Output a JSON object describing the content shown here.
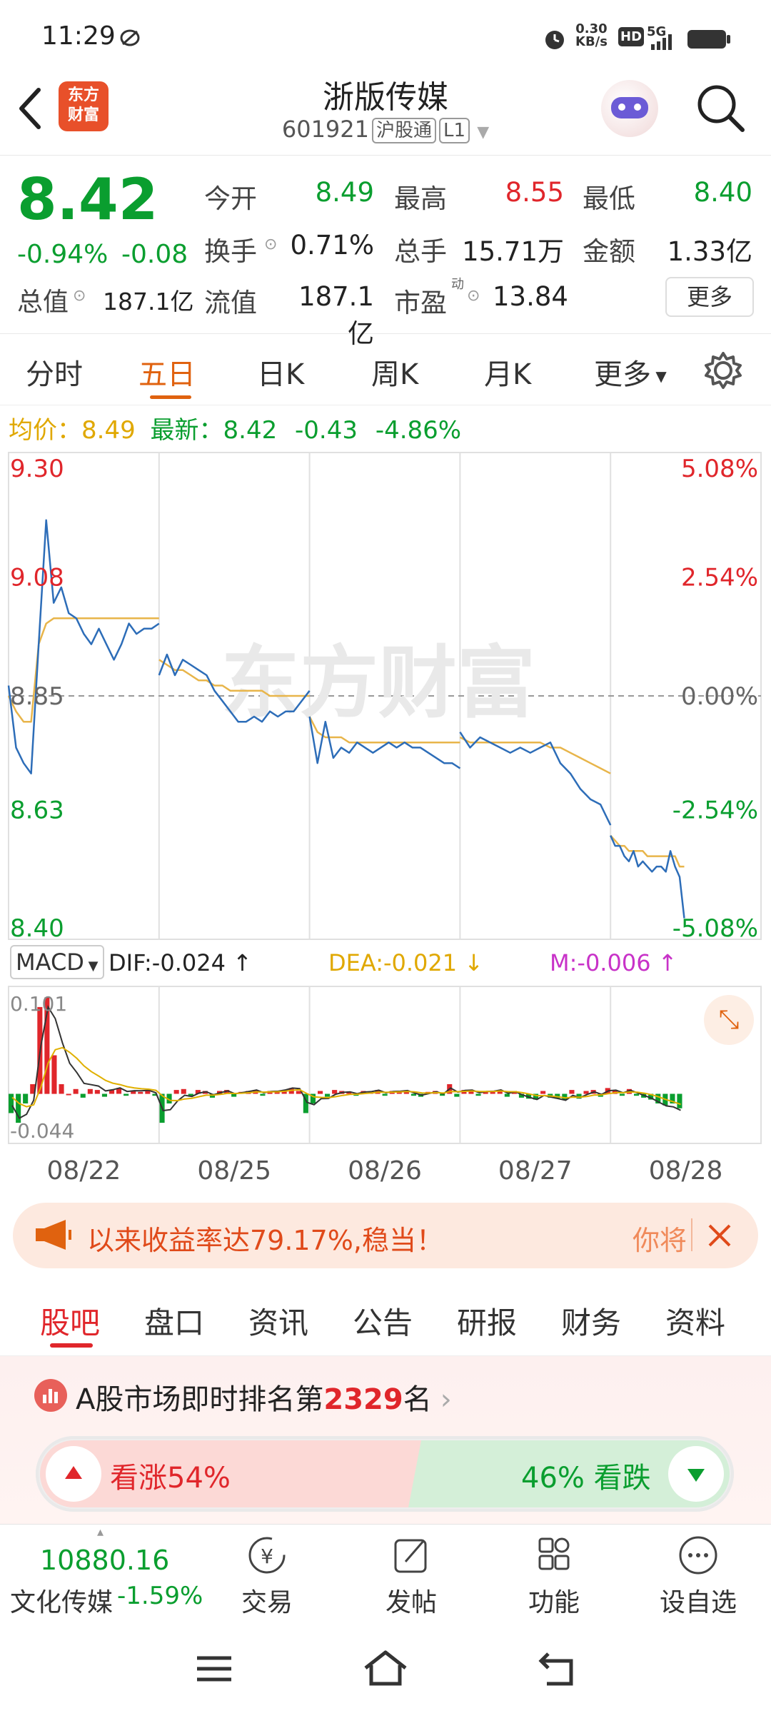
{
  "status_bar": {
    "time": "11:29",
    "net_speed_value": "0.30",
    "net_speed_unit": "KB/s",
    "hd_label": "HD",
    "signal_label": "5G"
  },
  "header": {
    "back_icon": "chevron-left-icon",
    "logo_line1": "东方",
    "logo_line2": "财富",
    "stock_name": "浙版传媒",
    "stock_code": "601921",
    "market_tag": "沪股通",
    "level_tag": "L1",
    "search_icon": "search-icon"
  },
  "quote": {
    "price": "8.42",
    "change_pct": "-0.94%",
    "change_amt": "-0.08",
    "open_label": "今开",
    "open_value": "8.49",
    "high_label": "最高",
    "high_value": "8.55",
    "low_label": "最低",
    "low_value": "8.40",
    "turnover_label": "换手",
    "turnover_value": "0.71%",
    "volume_label": "总手",
    "volume_value": "15.71万",
    "amount_label": "金额",
    "amount_value": "1.33亿",
    "mktcap_label": "总值",
    "mktcap_value": "187.1亿",
    "float_label": "流值",
    "float_value": "187.1亿",
    "pe_label": "市盈",
    "pe_sup": "动",
    "pe_value": "13.84",
    "more_button": "更多"
  },
  "period_tabs": {
    "items": [
      "分时",
      "五日",
      "日K",
      "周K",
      "月K",
      "更多"
    ],
    "active": "五日"
  },
  "info_line": {
    "avg_label": "均价：",
    "avg_value": "8.49",
    "latest_label": "最新：",
    "latest_value": "8.42",
    "change_amt": "-0.43",
    "change_pct": "-4.86%"
  },
  "chart_data": {
    "type": "line",
    "price_axis": {
      "ticks": [
        "9.30",
        "9.08",
        "8.85",
        "8.63",
        "8.40"
      ],
      "ylim": [
        8.4,
        9.3
      ],
      "ref": 8.85
    },
    "pct_axis": {
      "ticks": [
        "5.08%",
        "2.54%",
        "0.00%",
        "-2.54%",
        "-5.08%"
      ]
    },
    "watermark": "东方财富",
    "x_labels": [
      "08/22",
      "08/25",
      "08/26",
      "08/27",
      "08/28"
    ],
    "series": [
      {
        "name": "最新",
        "color": "#2d6db8",
        "values": [
          8.87,
          8.75,
          8.72,
          8.7,
          8.95,
          9.19,
          9.03,
          9.06,
          9.01,
          9.0,
          8.97,
          8.95,
          8.98,
          8.95,
          8.92,
          8.95,
          8.99,
          8.97,
          8.98,
          8.98,
          8.99,
          8.89,
          8.93,
          8.89,
          8.92,
          8.91,
          8.9,
          8.89,
          8.86,
          8.84,
          8.82,
          8.8,
          8.8,
          8.81,
          8.8,
          8.82,
          8.81,
          8.82,
          8.82,
          8.84,
          8.86,
          8.81,
          8.72,
          8.8,
          8.73,
          8.75,
          8.74,
          8.76,
          8.75,
          8.74,
          8.75,
          8.76,
          8.75,
          8.76,
          8.75,
          8.75,
          8.74,
          8.73,
          8.72,
          8.72,
          8.71,
          8.78,
          8.75,
          8.77,
          8.76,
          8.75,
          8.74,
          8.75,
          8.74,
          8.75,
          8.76,
          8.72,
          8.7,
          8.67,
          8.65,
          8.64,
          8.6,
          8.58,
          8.56,
          8.56,
          8.54,
          8.53,
          8.55,
          8.52,
          8.53,
          8.52,
          8.51,
          8.52,
          8.52,
          8.51,
          8.55,
          8.52,
          8.5,
          8.42
        ]
      },
      {
        "name": "均价",
        "color": "#e8b54a",
        "values": [
          8.85,
          8.82,
          8.8,
          8.8,
          8.95,
          8.99,
          9.0,
          9.0,
          9.0,
          9.0,
          9.0,
          9.0,
          9.0,
          9.0,
          9.0,
          9.0,
          9.0,
          9.0,
          9.0,
          9.0,
          9.0,
          8.92,
          8.91,
          8.9,
          8.9,
          8.89,
          8.88,
          8.88,
          8.87,
          8.87,
          8.86,
          8.86,
          8.86,
          8.86,
          8.86,
          8.85,
          8.85,
          8.85,
          8.85,
          8.85,
          8.85,
          8.81,
          8.78,
          8.77,
          8.77,
          8.77,
          8.76,
          8.76,
          8.76,
          8.76,
          8.76,
          8.76,
          8.76,
          8.76,
          8.76,
          8.76,
          8.76,
          8.76,
          8.76,
          8.76,
          8.76,
          8.77,
          8.76,
          8.76,
          8.76,
          8.76,
          8.76,
          8.76,
          8.76,
          8.76,
          8.75,
          8.75,
          8.74,
          8.73,
          8.72,
          8.71,
          8.7,
          8.58,
          8.57,
          8.56,
          8.56,
          8.55,
          8.55,
          8.55,
          8.55,
          8.54,
          8.54,
          8.54,
          8.54,
          8.54,
          8.54,
          8.54,
          8.52,
          8.52
        ]
      }
    ],
    "macd": {
      "dif": "-0.024",
      "dea": "-0.021",
      "m": "-0.006",
      "ymax_label": "0.101",
      "ymin_label": "-0.044",
      "dif_label": "DIF:",
      "dea_label": "DEA:",
      "m_label": "M:",
      "selector": "MACD",
      "bars": [
        -0.02,
        -0.03,
        -0.01,
        0.01,
        0.09,
        0.1,
        0.04,
        0.01,
        0.0,
        0.005,
        -0.004,
        0.005,
        0.004,
        -0.003,
        0.004,
        0.006,
        -0.002,
        0.003,
        0.002,
        0.003,
        -0.002,
        -0.03,
        -0.01,
        0.004,
        0.005,
        -0.003,
        0.004,
        0.003,
        -0.004,
        0.003,
        0.004,
        -0.003,
        0.002,
        0.003,
        0.004,
        -0.002,
        0.003,
        0.002,
        0.004,
        0.006,
        0.003,
        -0.02,
        -0.01,
        0.003,
        -0.003,
        0.004,
        0.003,
        0.002,
        -0.002,
        0.003,
        0.002,
        0.004,
        -0.002,
        0.003,
        0.002,
        0.003,
        -0.002,
        -0.003,
        0.002,
        0.003,
        -0.002,
        0.01,
        -0.003,
        0.004,
        0.003,
        -0.002,
        0.003,
        0.002,
        0.004,
        -0.003,
        0.003,
        -0.004,
        -0.005,
        -0.006,
        0.003,
        -0.004,
        -0.005,
        -0.006,
        0.004,
        -0.005,
        0.003,
        0.004,
        -0.003,
        0.006,
        0.003,
        -0.002,
        0.005,
        -0.002,
        -0.004,
        -0.006,
        -0.01,
        -0.012,
        -0.01,
        -0.015
      ]
    }
  },
  "banner": {
    "text": "以来收益率达79.17%,稳当！",
    "right_text": "你将",
    "icon": "megaphone-icon",
    "close_icon": "close-icon"
  },
  "news_tabs": {
    "items": [
      "股吧",
      "盘口",
      "资讯",
      "公告",
      "研报",
      "财务",
      "资料"
    ],
    "active": "股吧"
  },
  "ranking": {
    "prefix": "A股市场即时排名第",
    "rank": "2329",
    "suffix": "名",
    "bull_label": "看涨",
    "bull_pct": "54%",
    "bear_label": "看跌",
    "bear_pct": "46%"
  },
  "bottom_nav": {
    "index_value": "10880.16",
    "index_name": "文化传媒",
    "index_change": "-1.59%",
    "items": [
      {
        "label": "交易",
        "icon": "yen-icon"
      },
      {
        "label": "发帖",
        "icon": "edit-icon"
      },
      {
        "label": "功能",
        "icon": "grid-icon"
      },
      {
        "label": "设自选",
        "icon": "more-dots-icon"
      }
    ]
  },
  "colors": {
    "up": "#e0262b",
    "down": "#0a9e2f",
    "accent": "#e0620f",
    "price_line": "#2d6db8",
    "avg_line": "#e8b54a"
  }
}
